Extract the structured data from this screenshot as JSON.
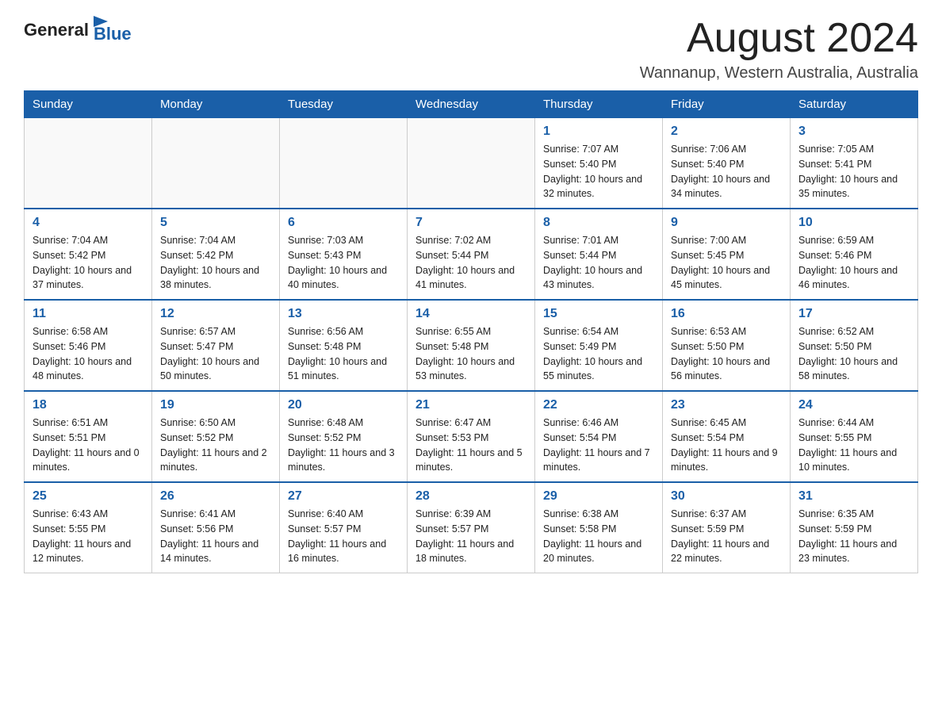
{
  "header": {
    "logo_general": "General",
    "logo_blue": "Blue",
    "month_title": "August 2024",
    "location": "Wannanup, Western Australia, Australia"
  },
  "days_of_week": [
    "Sunday",
    "Monday",
    "Tuesday",
    "Wednesday",
    "Thursday",
    "Friday",
    "Saturday"
  ],
  "weeks": [
    [
      {
        "day": "",
        "sunrise": "",
        "sunset": "",
        "daylight": ""
      },
      {
        "day": "",
        "sunrise": "",
        "sunset": "",
        "daylight": ""
      },
      {
        "day": "",
        "sunrise": "",
        "sunset": "",
        "daylight": ""
      },
      {
        "day": "",
        "sunrise": "",
        "sunset": "",
        "daylight": ""
      },
      {
        "day": "1",
        "sunrise": "Sunrise: 7:07 AM",
        "sunset": "Sunset: 5:40 PM",
        "daylight": "Daylight: 10 hours and 32 minutes."
      },
      {
        "day": "2",
        "sunrise": "Sunrise: 7:06 AM",
        "sunset": "Sunset: 5:40 PM",
        "daylight": "Daylight: 10 hours and 34 minutes."
      },
      {
        "day": "3",
        "sunrise": "Sunrise: 7:05 AM",
        "sunset": "Sunset: 5:41 PM",
        "daylight": "Daylight: 10 hours and 35 minutes."
      }
    ],
    [
      {
        "day": "4",
        "sunrise": "Sunrise: 7:04 AM",
        "sunset": "Sunset: 5:42 PM",
        "daylight": "Daylight: 10 hours and 37 minutes."
      },
      {
        "day": "5",
        "sunrise": "Sunrise: 7:04 AM",
        "sunset": "Sunset: 5:42 PM",
        "daylight": "Daylight: 10 hours and 38 minutes."
      },
      {
        "day": "6",
        "sunrise": "Sunrise: 7:03 AM",
        "sunset": "Sunset: 5:43 PM",
        "daylight": "Daylight: 10 hours and 40 minutes."
      },
      {
        "day": "7",
        "sunrise": "Sunrise: 7:02 AM",
        "sunset": "Sunset: 5:44 PM",
        "daylight": "Daylight: 10 hours and 41 minutes."
      },
      {
        "day": "8",
        "sunrise": "Sunrise: 7:01 AM",
        "sunset": "Sunset: 5:44 PM",
        "daylight": "Daylight: 10 hours and 43 minutes."
      },
      {
        "day": "9",
        "sunrise": "Sunrise: 7:00 AM",
        "sunset": "Sunset: 5:45 PM",
        "daylight": "Daylight: 10 hours and 45 minutes."
      },
      {
        "day": "10",
        "sunrise": "Sunrise: 6:59 AM",
        "sunset": "Sunset: 5:46 PM",
        "daylight": "Daylight: 10 hours and 46 minutes."
      }
    ],
    [
      {
        "day": "11",
        "sunrise": "Sunrise: 6:58 AM",
        "sunset": "Sunset: 5:46 PM",
        "daylight": "Daylight: 10 hours and 48 minutes."
      },
      {
        "day": "12",
        "sunrise": "Sunrise: 6:57 AM",
        "sunset": "Sunset: 5:47 PM",
        "daylight": "Daylight: 10 hours and 50 minutes."
      },
      {
        "day": "13",
        "sunrise": "Sunrise: 6:56 AM",
        "sunset": "Sunset: 5:48 PM",
        "daylight": "Daylight: 10 hours and 51 minutes."
      },
      {
        "day": "14",
        "sunrise": "Sunrise: 6:55 AM",
        "sunset": "Sunset: 5:48 PM",
        "daylight": "Daylight: 10 hours and 53 minutes."
      },
      {
        "day": "15",
        "sunrise": "Sunrise: 6:54 AM",
        "sunset": "Sunset: 5:49 PM",
        "daylight": "Daylight: 10 hours and 55 minutes."
      },
      {
        "day": "16",
        "sunrise": "Sunrise: 6:53 AM",
        "sunset": "Sunset: 5:50 PM",
        "daylight": "Daylight: 10 hours and 56 minutes."
      },
      {
        "day": "17",
        "sunrise": "Sunrise: 6:52 AM",
        "sunset": "Sunset: 5:50 PM",
        "daylight": "Daylight: 10 hours and 58 minutes."
      }
    ],
    [
      {
        "day": "18",
        "sunrise": "Sunrise: 6:51 AM",
        "sunset": "Sunset: 5:51 PM",
        "daylight": "Daylight: 11 hours and 0 minutes."
      },
      {
        "day": "19",
        "sunrise": "Sunrise: 6:50 AM",
        "sunset": "Sunset: 5:52 PM",
        "daylight": "Daylight: 11 hours and 2 minutes."
      },
      {
        "day": "20",
        "sunrise": "Sunrise: 6:48 AM",
        "sunset": "Sunset: 5:52 PM",
        "daylight": "Daylight: 11 hours and 3 minutes."
      },
      {
        "day": "21",
        "sunrise": "Sunrise: 6:47 AM",
        "sunset": "Sunset: 5:53 PM",
        "daylight": "Daylight: 11 hours and 5 minutes."
      },
      {
        "day": "22",
        "sunrise": "Sunrise: 6:46 AM",
        "sunset": "Sunset: 5:54 PM",
        "daylight": "Daylight: 11 hours and 7 minutes."
      },
      {
        "day": "23",
        "sunrise": "Sunrise: 6:45 AM",
        "sunset": "Sunset: 5:54 PM",
        "daylight": "Daylight: 11 hours and 9 minutes."
      },
      {
        "day": "24",
        "sunrise": "Sunrise: 6:44 AM",
        "sunset": "Sunset: 5:55 PM",
        "daylight": "Daylight: 11 hours and 10 minutes."
      }
    ],
    [
      {
        "day": "25",
        "sunrise": "Sunrise: 6:43 AM",
        "sunset": "Sunset: 5:55 PM",
        "daylight": "Daylight: 11 hours and 12 minutes."
      },
      {
        "day": "26",
        "sunrise": "Sunrise: 6:41 AM",
        "sunset": "Sunset: 5:56 PM",
        "daylight": "Daylight: 11 hours and 14 minutes."
      },
      {
        "day": "27",
        "sunrise": "Sunrise: 6:40 AM",
        "sunset": "Sunset: 5:57 PM",
        "daylight": "Daylight: 11 hours and 16 minutes."
      },
      {
        "day": "28",
        "sunrise": "Sunrise: 6:39 AM",
        "sunset": "Sunset: 5:57 PM",
        "daylight": "Daylight: 11 hours and 18 minutes."
      },
      {
        "day": "29",
        "sunrise": "Sunrise: 6:38 AM",
        "sunset": "Sunset: 5:58 PM",
        "daylight": "Daylight: 11 hours and 20 minutes."
      },
      {
        "day": "30",
        "sunrise": "Sunrise: 6:37 AM",
        "sunset": "Sunset: 5:59 PM",
        "daylight": "Daylight: 11 hours and 22 minutes."
      },
      {
        "day": "31",
        "sunrise": "Sunrise: 6:35 AM",
        "sunset": "Sunset: 5:59 PM",
        "daylight": "Daylight: 11 hours and 23 minutes."
      }
    ]
  ]
}
